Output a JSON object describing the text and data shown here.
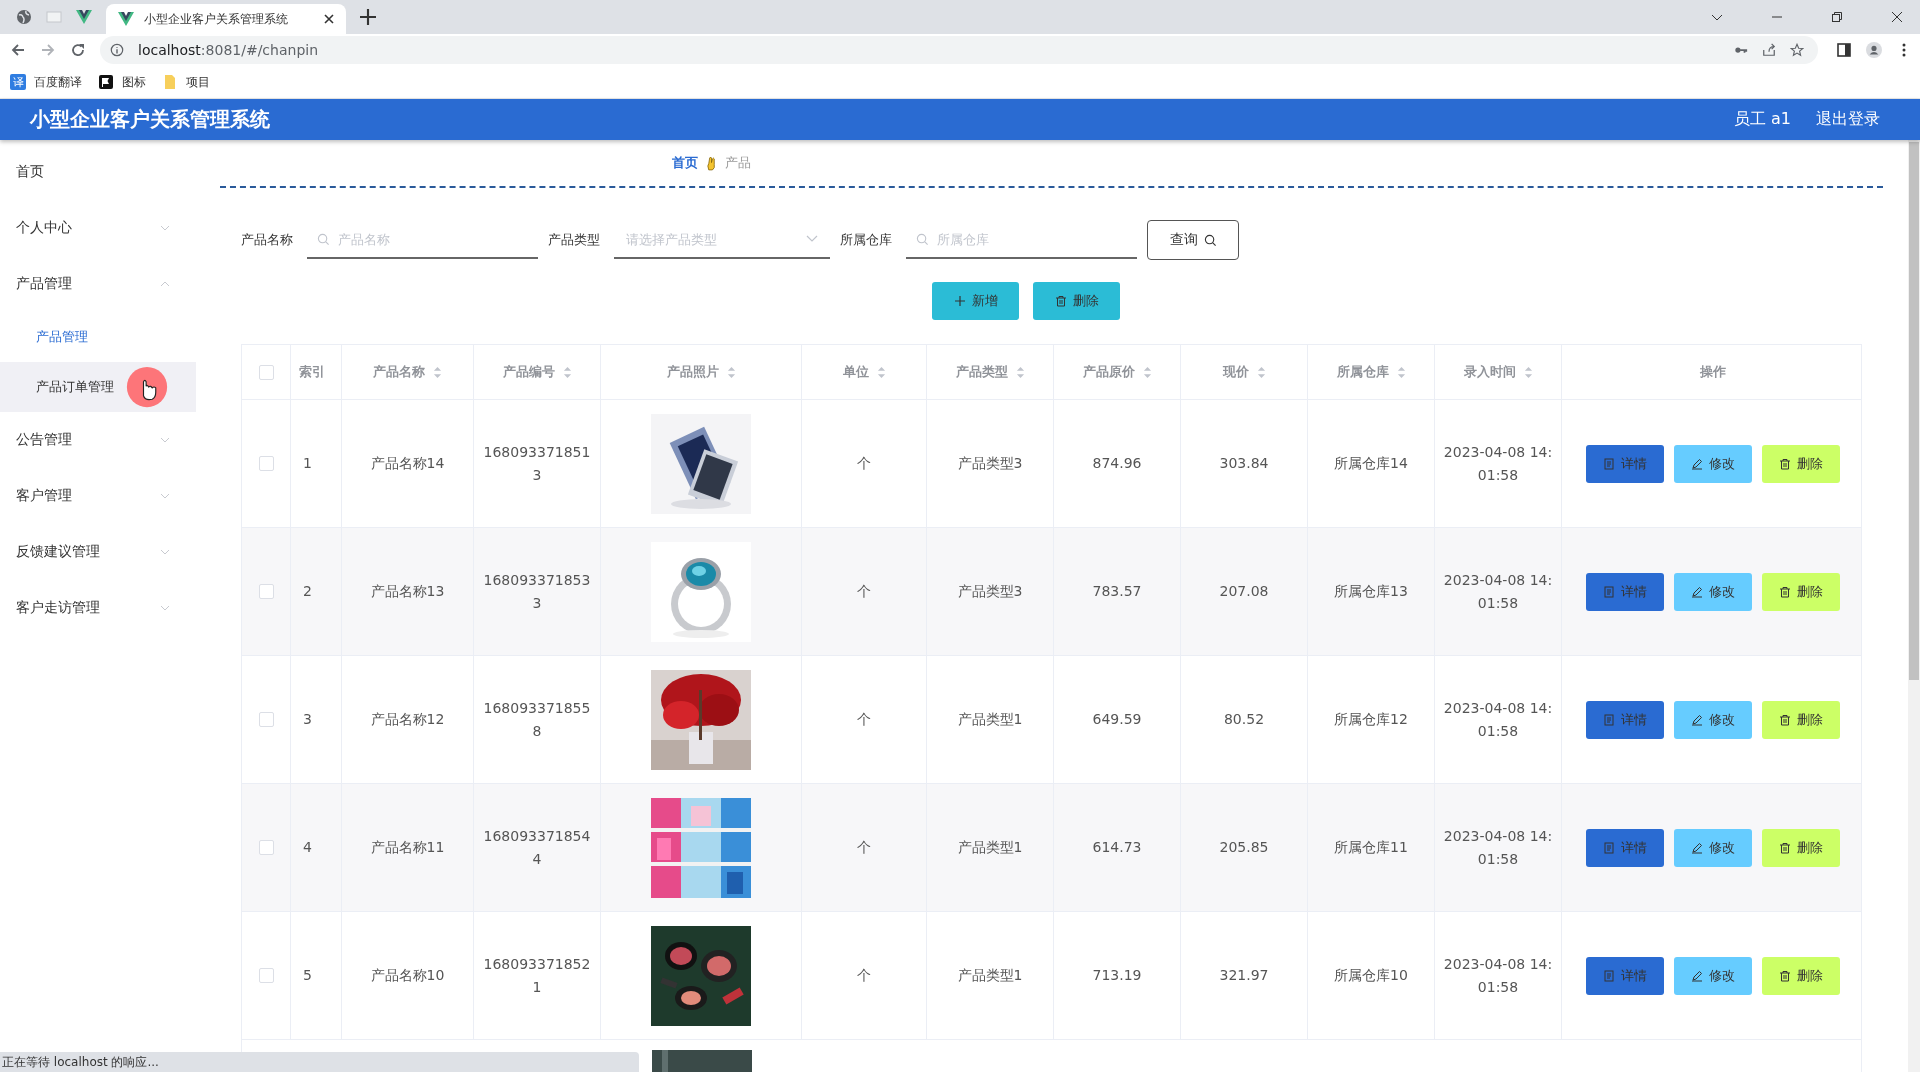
{
  "browser": {
    "tab_title": "小型企业客户关系管理系统",
    "url_host": "localhost",
    "url_rest": ":8081/#/chanpin",
    "bookmarks": [
      {
        "kind": "translate",
        "label": "百度翻译",
        "icon_text": "译"
      },
      {
        "kind": "flag",
        "label": "图标"
      },
      {
        "kind": "folder",
        "label": "项目"
      }
    ],
    "status": "正在等待 localhost 的响应..."
  },
  "header": {
    "title": "小型企业客户关系管理系统",
    "user": "员工 a1",
    "logout": "退出登录"
  },
  "sidebar": {
    "items": [
      {
        "label": "首页"
      },
      {
        "label": "个人中心",
        "expanded": false
      },
      {
        "label": "产品管理",
        "expanded": true,
        "children": [
          {
            "label": "产品管理",
            "selected": true,
            "hovered": false
          },
          {
            "label": "产品订单管理",
            "selected": false,
            "hovered": true
          }
        ]
      },
      {
        "label": "公告管理",
        "expanded": false
      },
      {
        "label": "客户管理",
        "expanded": false
      },
      {
        "label": "反馈建议管理",
        "expanded": false
      },
      {
        "label": "客户走访管理",
        "expanded": false
      }
    ]
  },
  "breadcrumb": [
    "首页",
    "产品"
  ],
  "filters": [
    {
      "label": "产品名称",
      "kind": "search",
      "placeholder": "产品名称"
    },
    {
      "label": "产品类型",
      "kind": "select",
      "placeholder": "请选择产品类型"
    },
    {
      "label": "所属仓库",
      "kind": "search",
      "placeholder": "所属仓库"
    }
  ],
  "query_button": "查询",
  "actions": [
    {
      "kind": "add",
      "label": "新增"
    },
    {
      "kind": "delete",
      "label": "删除"
    }
  ],
  "table": {
    "select_all_checked": false,
    "columns": [
      {
        "label": "索引",
        "sortable": false
      },
      {
        "label": "产品名称",
        "sortable": true
      },
      {
        "label": "产品编号",
        "sortable": true
      },
      {
        "label": "产品照片",
        "sortable": true
      },
      {
        "label": "单位",
        "sortable": true
      },
      {
        "label": "产品类型",
        "sortable": true
      },
      {
        "label": "产品原价",
        "sortable": true
      },
      {
        "label": "现价",
        "sortable": true
      },
      {
        "label": "所属仓库",
        "sortable": true
      },
      {
        "label": "录入时间",
        "sortable": true
      },
      {
        "label": "操作",
        "sortable": false
      }
    ],
    "rows": [
      {
        "checked": false,
        "index": "1",
        "name": "产品名称14",
        "code": "1680933718513",
        "unit": "个",
        "type": "产品类型3",
        "price": "874.96",
        "current": "303.84",
        "warehouse": "所属仓库14",
        "time": "2023-04-08 14:01:58",
        "buttons": [
          {
            "kind": "detail",
            "label": "详情"
          },
          {
            "kind": "edit",
            "label": "修改"
          },
          {
            "kind": "delete",
            "label": "删除"
          }
        ]
      },
      {
        "checked": false,
        "index": "2",
        "name": "产品名称13",
        "code": "1680933718533",
        "unit": "个",
        "type": "产品类型3",
        "price": "783.57",
        "current": "207.08",
        "warehouse": "所属仓库13",
        "time": "2023-04-08 14:01:58",
        "buttons": [
          {
            "kind": "detail",
            "label": "详情"
          },
          {
            "kind": "edit",
            "label": "修改"
          },
          {
            "kind": "delete",
            "label": "删除"
          }
        ]
      },
      {
        "checked": false,
        "index": "3",
        "name": "产品名称12",
        "code": "1680933718558",
        "unit": "个",
        "type": "产品类型1",
        "price": "649.59",
        "current": "80.52",
        "warehouse": "所属仓库12",
        "time": "2023-04-08 14:01:58",
        "buttons": [
          {
            "kind": "detail",
            "label": "详情"
          },
          {
            "kind": "edit",
            "label": "修改"
          },
          {
            "kind": "delete",
            "label": "删除"
          }
        ]
      },
      {
        "checked": false,
        "index": "4",
        "name": "产品名称11",
        "code": "1680933718544",
        "unit": "个",
        "type": "产品类型1",
        "price": "614.73",
        "current": "205.85",
        "warehouse": "所属仓库11",
        "time": "2023-04-08 14:01:58",
        "buttons": [
          {
            "kind": "detail",
            "label": "详情"
          },
          {
            "kind": "edit",
            "label": "修改"
          },
          {
            "kind": "delete",
            "label": "删除"
          }
        ]
      },
      {
        "checked": false,
        "index": "5",
        "name": "产品名称10",
        "code": "1680933718521",
        "unit": "个",
        "type": "产品类型1",
        "price": "713.19",
        "current": "321.97",
        "warehouse": "所属仓库10",
        "time": "2023-04-08 14:01:58",
        "buttons": [
          {
            "kind": "detail",
            "label": "详情"
          },
          {
            "kind": "edit",
            "label": "修改"
          },
          {
            "kind": "delete",
            "label": "删除"
          }
        ]
      }
    ]
  }
}
